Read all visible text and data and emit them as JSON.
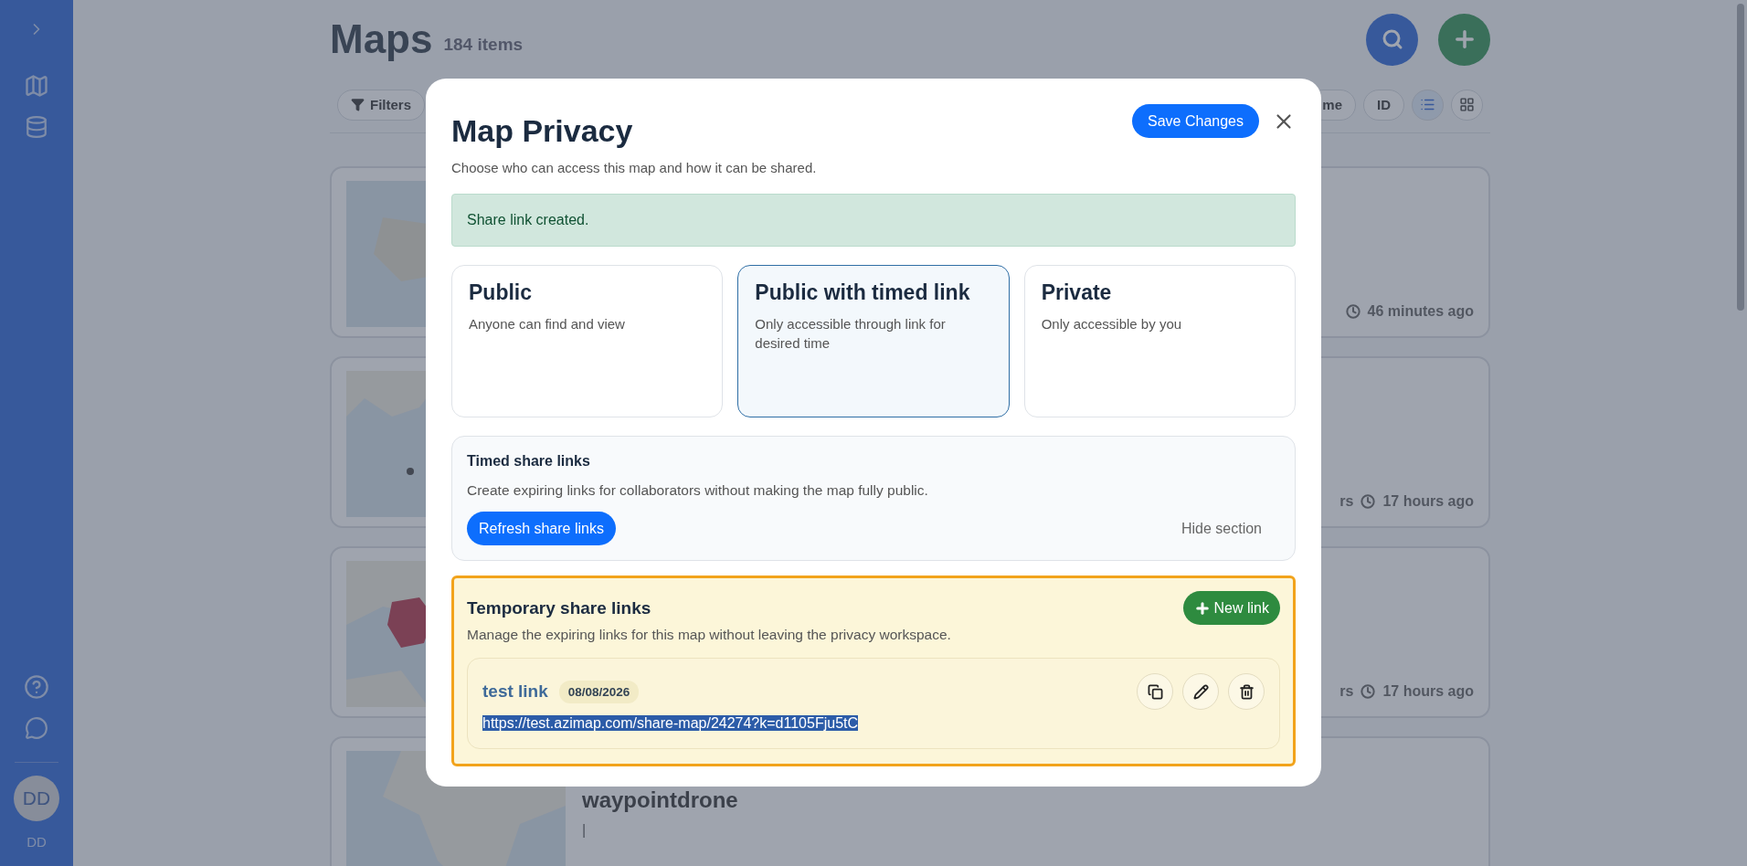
{
  "sidebar": {
    "avatar": "DD",
    "user_label": "DD"
  },
  "page": {
    "title": "Maps",
    "count": "184 items",
    "toolbar": {
      "filters": "Filters",
      "buttons": [
        "me",
        "ID"
      ],
      "view_modes": [
        {
          "kind": "list",
          "selected": true
        },
        {
          "kind": "grid",
          "selected": false
        }
      ]
    },
    "cards": [
      {
        "kind": "picture",
        "time": "46 minutes ago"
      },
      {
        "kind": "picture",
        "prefix": "rs",
        "time": "17 hours ago"
      },
      {
        "kind": "picture",
        "prefix": "rs",
        "time": "17 hours ago"
      },
      {
        "kind": "picture",
        "title": "waypointdrone",
        "description": "|"
      }
    ]
  },
  "modal": {
    "title": "Map Privacy",
    "subtitle": "Choose who can access this map and how it can be shared.",
    "save_button": "Save Changes",
    "alert": "Share link created.",
    "options": [
      {
        "title": "Public",
        "description": "Anyone can find and view",
        "selected": false
      },
      {
        "title": "Public with timed link",
        "description": "Only accessible through link for desired time",
        "selected": true
      },
      {
        "title": "Private",
        "description": "Only accessible by you",
        "selected": false
      }
    ],
    "timed": {
      "title": "Timed share links",
      "description": "Create expiring links for collaborators without making the map fully public.",
      "refresh_button": "Refresh share links",
      "hide_link": "Hide section"
    },
    "temporary": {
      "highlighted": true,
      "title": "Temporary share links",
      "description": "Manage the expiring links for this map without leaving the privacy workspace.",
      "new_button": "New link",
      "links": [
        {
          "name": "test link",
          "date": "08/08/2026",
          "url": "https://test.azimap.com/share-map/24274?k=d1105Fju5tC",
          "url_selected": true
        }
      ]
    }
  }
}
